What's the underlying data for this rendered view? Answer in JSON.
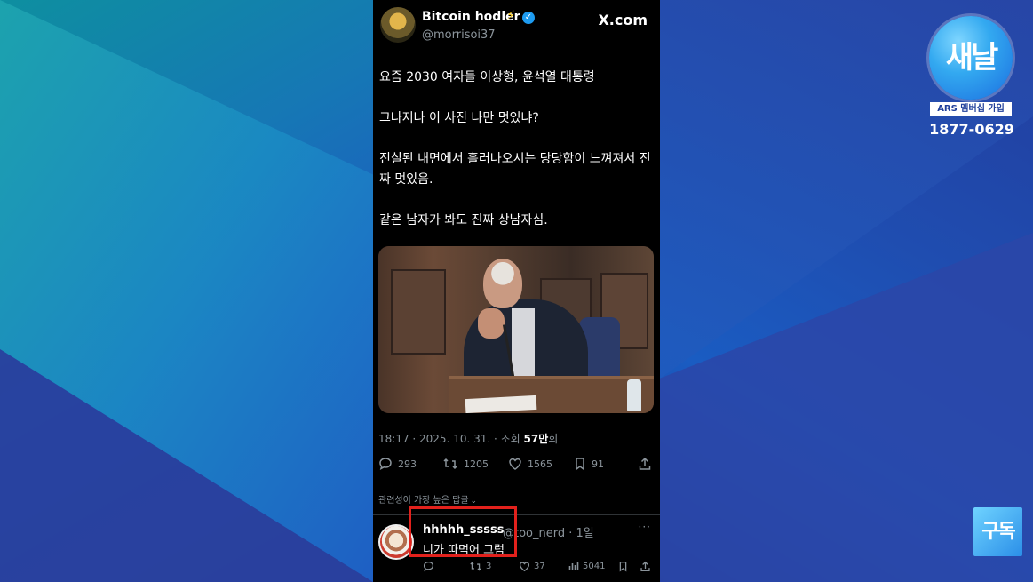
{
  "tweet": {
    "author_name": "Bitcoin hodler",
    "author_emoji": "⚡",
    "verified_mark": "✓",
    "handle": "@morrisoi37",
    "site": "X.com",
    "paragraphs": [
      "요즘 2030 여자들 이상형, 윤석열 대통령",
      "그나저나 이 사진 나만 멋있냐?",
      "진실된 내면에서 흘러나오시는 당당함이 느껴져서 진짜 멋있음.",
      "같은 남자가 봐도 진짜 상남자심."
    ],
    "timestamp": "18:17 · 2025. 10. 31. · 조회 ",
    "views_value": "57만",
    "views_suffix": "회",
    "stats": {
      "replies": "293",
      "reposts": "1205",
      "likes": "1565",
      "bookmarks": "91"
    }
  },
  "replies_section": {
    "sort_label": "관련성이 가장 높은 답글",
    "sort_chevron": "⌄"
  },
  "reply": {
    "name": "hhhhh_sssss",
    "handle": "@too_nerd · 1일",
    "more": "···",
    "text": "니가 따먹어 그럼",
    "stats": {
      "reposts": "3",
      "likes": "37",
      "views": "5041"
    }
  },
  "branding": {
    "logo_text": "새날",
    "ars_label": "ARS 멤버십 가입",
    "phone": "1877-0629",
    "subscribe_label": "구독"
  },
  "colors": {
    "highlight_box": "#e2211c",
    "verified_blue": "#1d9bf0",
    "logo_blue": "#33a9f0"
  }
}
